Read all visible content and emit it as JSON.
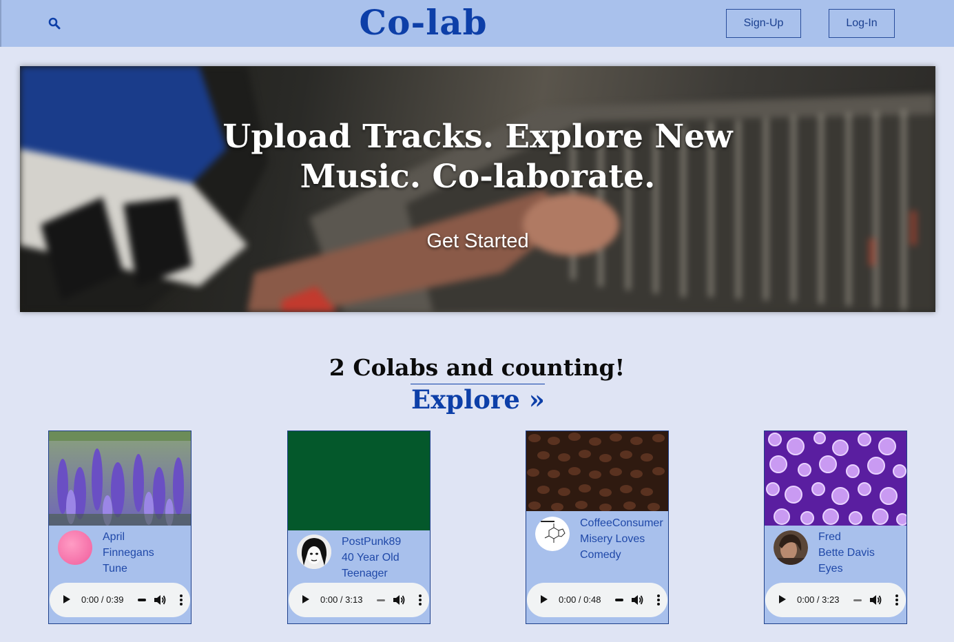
{
  "header": {
    "logo": "Co-lab",
    "signup_label": "Sign-Up",
    "login_label": "Log-In",
    "search_icon": "search-icon"
  },
  "hero": {
    "title_line1": "Upload Tracks. Explore New",
    "title_line2": "Music. Co-laborate.",
    "cta": "Get Started"
  },
  "counter": {
    "text": "2 Colabs and counting!",
    "explore": "Explore »"
  },
  "tracks": [
    {
      "title_lines": [
        "April",
        "Finnegans",
        "Tune"
      ],
      "time": "0:00 / 0:39"
    },
    {
      "title_lines": [
        "PostPunk89",
        "40 Year Old",
        "Teenager"
      ],
      "time": "0:00 / 3:13"
    },
    {
      "title_lines": [
        "CoffeeConsumer",
        "Misery Loves",
        "Comedy"
      ],
      "time": "0:00 / 0:48"
    },
    {
      "title_lines": [
        "Fred",
        "Bette Davis",
        "Eyes"
      ],
      "time": "0:00 / 3:23"
    }
  ],
  "colors": {
    "accent": "#0d3fa8",
    "header_bg": "#a9c1ec",
    "page_bg": "#dfe4f4",
    "card_bg": "#a8c0ec"
  }
}
